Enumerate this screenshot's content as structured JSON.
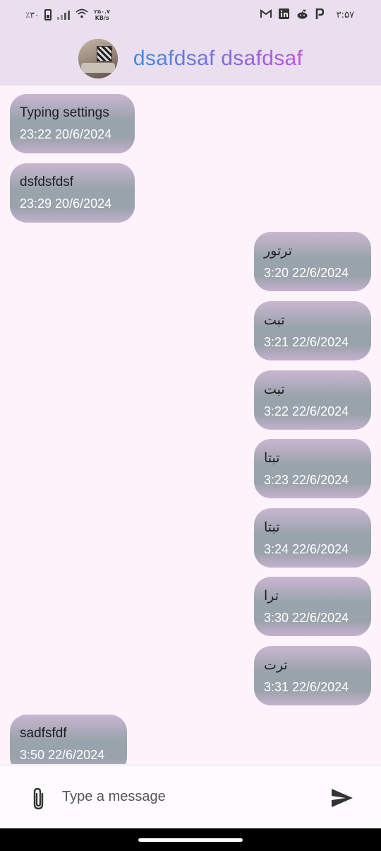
{
  "status_bar": {
    "battery_percent": "٪۳۰",
    "net_speed_value": "۲۵۰.۷",
    "net_speed_unit": "KB/s",
    "notification_icons": [
      "gmail-icon",
      "linkedin-icon",
      "reddit-icon",
      "p-icon"
    ],
    "clock": "۳:۵۷"
  },
  "header": {
    "contact_name": "dsafdsaf dsafdsaf"
  },
  "messages": [
    {
      "direction": "in",
      "text": "Typing settings",
      "time": "23:22 20/6/2024"
    },
    {
      "direction": "in",
      "text": "dsfdsfdsf",
      "time": "23:29 20/6/2024"
    },
    {
      "direction": "out",
      "text": "ترتور",
      "time": "3:20 22/6/2024"
    },
    {
      "direction": "out",
      "text": "تبت",
      "time": "3:21 22/6/2024"
    },
    {
      "direction": "out",
      "text": "تبت",
      "time": "3:22 22/6/2024"
    },
    {
      "direction": "out",
      "text": "تبتا",
      "time": "3:23 22/6/2024"
    },
    {
      "direction": "out",
      "text": "تبتا",
      "time": "3:24 22/6/2024"
    },
    {
      "direction": "out",
      "text": "ترا",
      "time": "3:30 22/6/2024"
    },
    {
      "direction": "out",
      "text": "ترت",
      "time": "3:31 22/6/2024"
    },
    {
      "direction": "in",
      "text": "sadfsfdf",
      "time": "3:50 22/6/2024"
    }
  ],
  "composer": {
    "placeholder": "Type a message",
    "value": ""
  },
  "colors": {
    "app_bar": "#e9dfee",
    "background": "#fcf3fb",
    "title_gradient_start": "#3a8ee0",
    "title_gradient_end": "#c74fe0"
  }
}
